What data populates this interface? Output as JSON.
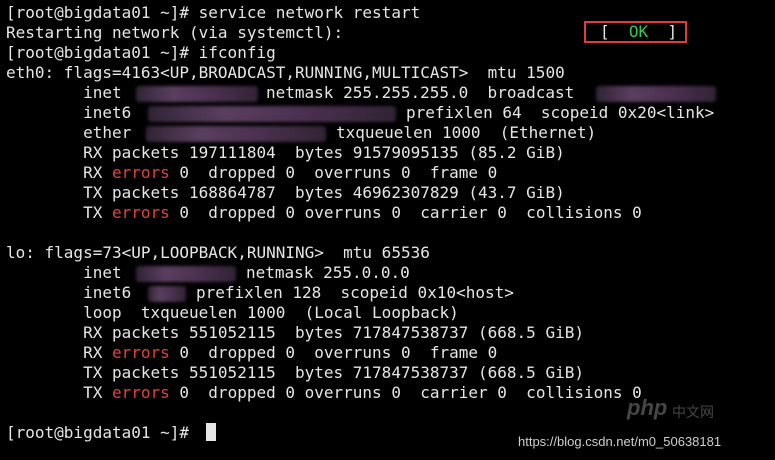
{
  "terminal": {
    "lines": {
      "l0": "[root@bigdata01 ~]# service network restart",
      "l1": "Restarting network (via systemctl):",
      "l2": "[root@bigdata01 ~]# ifconfig",
      "l3": "eth0: flags=4163<UP,BROADCAST,RUNNING,MULTICAST>  mtu 1500",
      "l4a": "        inet",
      "l4b": "netmask 255.255.255.0  broadcast",
      "l5a": "        inet6",
      "l5b": "prefixlen 64  scopeid 0x20<link>",
      "l6a": "        ether",
      "l6b": "txqueuelen 1000  (Ethernet)",
      "l7": "        RX packets 197111804  bytes 91579095135 (85.2 GiB)",
      "l8a": "        RX ",
      "l8b": "errors",
      "l8c": " 0  dropped 0  overruns 0  frame 0",
      "l9": "        TX packets 168864787  bytes 46962307829 (43.7 GiB)",
      "l10a": "        TX ",
      "l10b": "errors",
      "l10c": " 0  dropped 0 overruns 0  carrier 0  collisions 0",
      "l12": "lo: flags=73<UP,LOOPBACK,RUNNING>  mtu 65536",
      "l13a": "        inet",
      "l13b": "netmask 255.0.0.0",
      "l14a": "        inet6",
      "l14b": "prefixlen 128  scopeid 0x10<host>",
      "l15": "        loop  txqueuelen 1000  (Local Loopback)",
      "l16": "        RX packets 551052115  bytes 717847538737 (668.5 GiB)",
      "l17a": "        RX ",
      "l17b": "errors",
      "l17c": " 0  dropped 0  overruns 0  frame 0",
      "l18": "        TX packets 551052115  bytes 717847538737 (668.5 GiB)",
      "l19a": "        TX ",
      "l19b": "errors",
      "l19c": " 0  dropped 0 overruns 0  carrier 0  collisions 0",
      "l21": "[root@bigdata01 ~]# "
    },
    "ok": {
      "open": "[  ",
      "label": "OK",
      "close": "  ]"
    }
  },
  "watermark": {
    "logo": "php",
    "logo_cn": "中文网",
    "url": "https://blog.csdn.net/m0_50638181"
  },
  "colors": {
    "background": "#000000",
    "foreground": "#e6e6e6",
    "error": "#e04040",
    "ok": "#2ecc52",
    "highlight_box": "#e23b3b"
  }
}
